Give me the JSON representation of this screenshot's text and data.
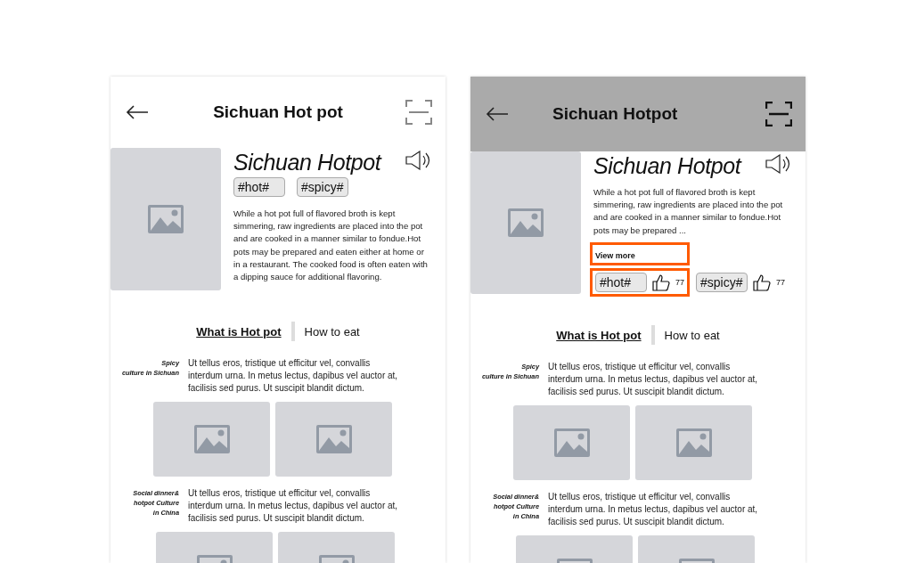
{
  "screens": [
    {
      "header": {
        "title": "Sichuan Hot pot",
        "shaded": false
      },
      "hero": {
        "heading": "Sichuan Hotpot",
        "description": "While a hot pot full of flavored broth is kept simmering, raw ingredients are placed into the pot and are cooked in a manner similar to fondue.Hot pots may be prepared and eaten either at home or in a restaurant. The cooked food is often eaten with a dipping sauce for additional flavoring."
      },
      "tags": [
        {
          "label": "#hot#",
          "highlighted": false
        },
        {
          "label": "#spicy#",
          "highlighted": false
        }
      ],
      "tabs": [
        {
          "label": "What is Hot pot",
          "selected": true
        },
        {
          "label": "How to eat",
          "selected": false
        }
      ],
      "sections": [
        {
          "caption": "Spicy\nculture in Sichuan",
          "text": "Ut tellus eros, tristique ut efficitur vel, convallis interdum urna. In metus lectus, dapibus vel auctor at, facilisis sed purus. Ut suscipit blandit dictum."
        },
        {
          "caption": "Social dinner&\nhotpot Culture\nin China",
          "text": "Ut tellus eros, tristique ut efficitur vel, convallis interdum urna. In metus lectus, dapibus vel auctor at, facilisis sed purus. Ut suscipit blandit dictum."
        }
      ]
    },
    {
      "header": {
        "title": "Sichuan Hotpot",
        "shaded": true
      },
      "hero": {
        "heading": "Sichuan Hotpot",
        "description": "While a hot pot full of flavored broth is kept simmering, raw ingredients are placed into the pot and are cooked in a manner similar to fondue.Hot pots may be prepared ...",
        "view_more": {
          "label": "View more",
          "highlighted": true
        }
      },
      "tags": [
        {
          "label": "#hot#",
          "likes": "77",
          "highlighted": true
        },
        {
          "label": "#spicy#",
          "likes": "77",
          "highlighted": false
        }
      ],
      "tabs": [
        {
          "label": "What is Hot pot",
          "selected": true
        },
        {
          "label": "How to eat",
          "selected": false
        }
      ],
      "sections": [
        {
          "caption": "Spicy\nculture in Sichuan",
          "text": "Ut tellus eros, tristique ut efficitur vel, convallis interdum urna. In metus lectus, dapibus vel auctor at, facilisis sed purus. Ut suscipit blandit dictum."
        },
        {
          "caption": "Social dinner&\nhotpot Culture\nin China",
          "text": "Ut tellus eros, tristique ut efficitur vel, convallis interdum urna. In metus lectus, dapibus vel auctor at, facilisis sed purus. Ut suscipit blandit dictum."
        }
      ]
    }
  ]
}
